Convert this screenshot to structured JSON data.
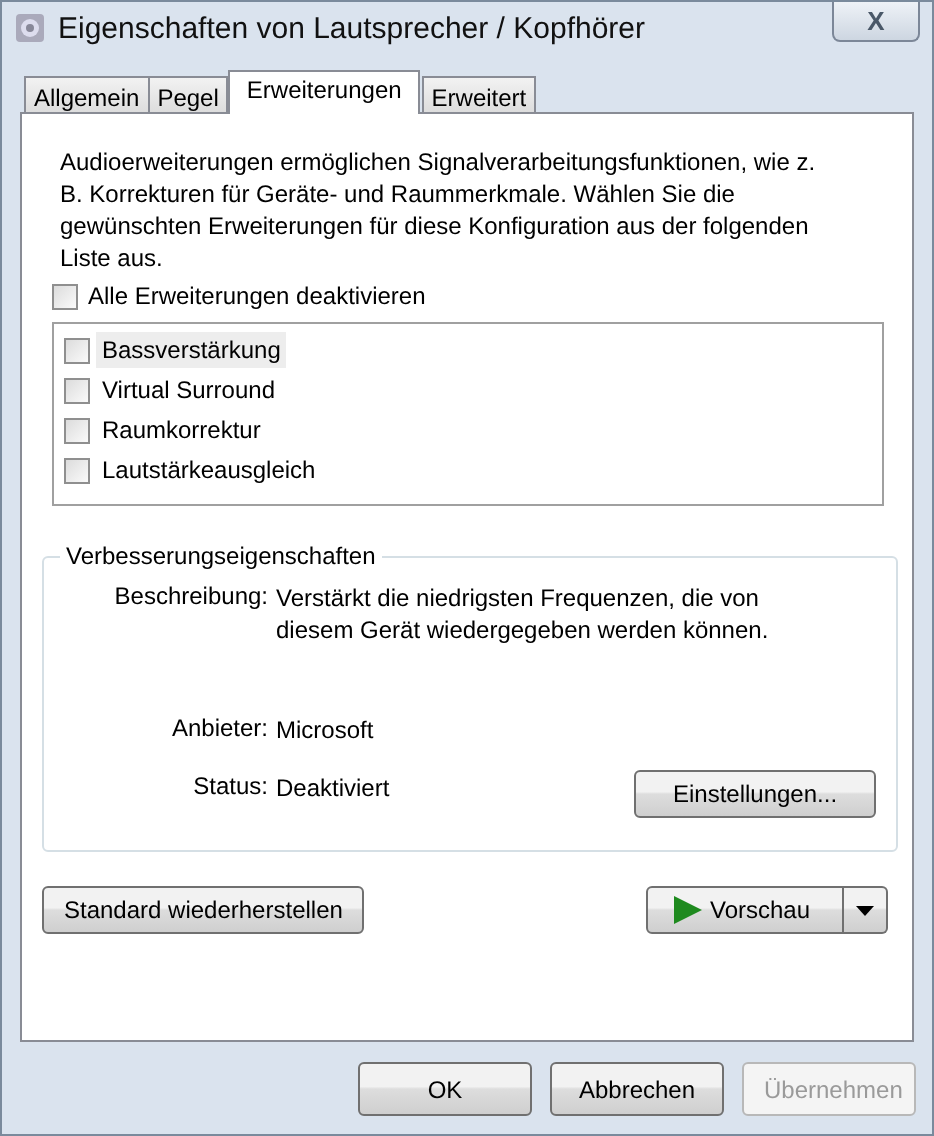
{
  "window": {
    "title": "Eigenschaften von Lautsprecher / Kopfhörer",
    "close": "X"
  },
  "tabs": [
    {
      "label": "Allgemein",
      "selected": false
    },
    {
      "label": "Pegel",
      "selected": false
    },
    {
      "label": "Erweiterungen",
      "selected": true
    },
    {
      "label": "Erweitert",
      "selected": false
    }
  ],
  "intro": "Audioerweiterungen ermöglichen Signalverarbeitungsfunktionen, wie z. B. Korrekturen für Geräte- und Raummerkmale. Wählen Sie die gewünschten Erweiterungen für diese Konfiguration aus der folgenden Liste aus.",
  "disable_all": {
    "label": "Alle Erweiterungen deaktivieren",
    "checked": false
  },
  "enhancements": [
    {
      "label": "Bassverstärkung",
      "checked": false,
      "selected": true
    },
    {
      "label": "Virtual Surround",
      "checked": false,
      "selected": false
    },
    {
      "label": "Raumkorrektur",
      "checked": false,
      "selected": false
    },
    {
      "label": "Lautstärkeausgleich",
      "checked": false,
      "selected": false
    }
  ],
  "properties": {
    "title": "Verbesserungseigenschaften",
    "fields": [
      {
        "label": "Beschreibung:",
        "value": "Verstärkt die niedrigsten Frequenzen, die von diesem Gerät wiedergegeben werden können."
      },
      {
        "label": "Anbieter:",
        "value": "Microsoft"
      },
      {
        "label": "Status:",
        "value": "Deaktiviert"
      }
    ],
    "settings_button": "Einstellungen..."
  },
  "restore_button": "Standard wiederherstellen",
  "preview_button": "Vorschau",
  "buttons": [
    {
      "label": "OK",
      "disabled": false
    },
    {
      "label": "Abbrechen",
      "disabled": false
    },
    {
      "label": "Übernehmen",
      "disabled": true
    }
  ]
}
